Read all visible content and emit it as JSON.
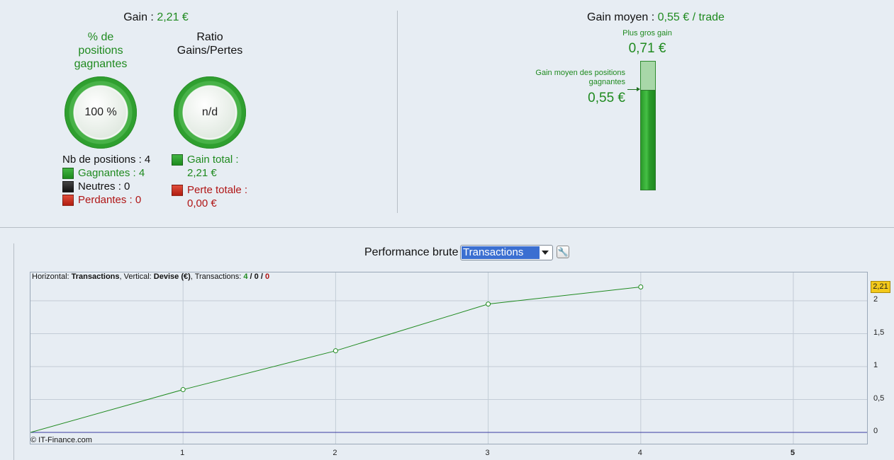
{
  "left_panel": {
    "gain_label": "Gain :",
    "gain_value": "2,21 €",
    "pct_title": "% de\npositions\ngagnantes",
    "pct_value": "100 %",
    "ratio_title": "Ratio\nGains/Pertes",
    "ratio_value": "n/d",
    "nb_positions": "Nb de positions : 4",
    "gagnantes": "Gagnantes : 4",
    "neutres": "Neutres : 0",
    "perdantes": "Perdantes : 0",
    "gain_total_label": "Gain total :",
    "gain_total_value": "2,21 €",
    "perte_totale_label": "Perte totale :",
    "perte_totale_value": "0,00 €"
  },
  "right_panel": {
    "gain_moyen_label": "Gain moyen :",
    "gain_moyen_value": "0,55 € / trade",
    "plus_gros_gain_label": "Plus gros gain",
    "plus_gros_gain_value": "0,71 €",
    "gain_moyen_positions_label": "Gain moyen des positions\ngagnantes",
    "gain_moyen_positions_value": "0,55 €",
    "bar_max": 0.71,
    "bar_avg": 0.55
  },
  "chart_section": {
    "title": "Performance brute",
    "select_value": "Transactions",
    "info_prefix": "Horizontal: ",
    "info_h": "Transactions",
    "info_mid": ", Vertical: ",
    "info_v": "Devise (€)",
    "info_tx": ", Transactions: ",
    "info_win": "4",
    "info_sep1": " / ",
    "info_neutral": "0",
    "info_sep2": " / ",
    "info_loss": "0",
    "copyright": "© IT-Finance.com",
    "last_value_badge": "2,21"
  },
  "chart_data": {
    "type": "line",
    "x": [
      0,
      1,
      2,
      3,
      4
    ],
    "series": [
      {
        "values": [
          0,
          0.65,
          1.24,
          1.95,
          2.21
        ],
        "color": "#1f8a1f"
      }
    ],
    "x_ticks": [
      "1",
      "2",
      "3",
      "4",
      "5"
    ],
    "y_ticks": [
      "0",
      "0,5",
      "1",
      "1,5",
      "2"
    ],
    "xlim": [
      0,
      5.5
    ],
    "ylim": [
      0,
      2.4
    ],
    "grid": true
  }
}
